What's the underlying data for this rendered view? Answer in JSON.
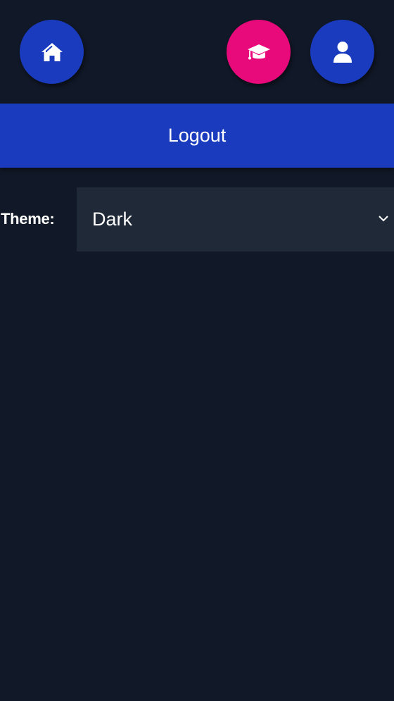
{
  "nav": {
    "home_icon": "home-icon",
    "learn_icon": "graduation-cap-icon",
    "profile_icon": "user-icon"
  },
  "colors": {
    "background": "#111827",
    "primary": "#1a3bbd",
    "accent": "#e8097a",
    "select_bg": "#1f2937",
    "text": "#ffffff"
  },
  "logout": {
    "label": "Logout"
  },
  "theme": {
    "label": "Theme:",
    "selected": "Dark",
    "dropdown_icon": "chevron-down-icon"
  }
}
